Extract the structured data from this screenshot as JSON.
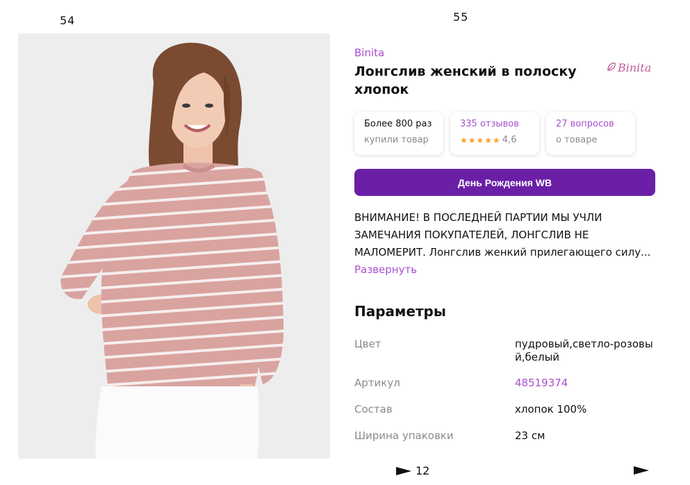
{
  "pages": {
    "left": "54",
    "right": "55"
  },
  "product": {
    "brand": "Binita",
    "title": "Лонгслив женский в полоску хлопок",
    "logo_text": "Binita"
  },
  "stats": [
    {
      "line1": "Более 800 раз",
      "line2": "купили товар"
    },
    {
      "line1": "335 отзывов",
      "line2": "4,6",
      "stars": "★★★★★"
    },
    {
      "line1": "27 вопросов",
      "line2": "о товаре"
    }
  ],
  "promo_label": "День Рождения WB",
  "description": "ВНИМАНИЕ! В ПОСЛЕДНЕЙ ПАРТИИ МЫ УЧЛИ ЗАМЕЧАНИЯ ПОКУПАТЕЛЕЙ, ЛОНГСЛИВ НЕ МАЛОМЕРИТ. Лонгслив женкий прилегающего силу...",
  "expand_label": "Развернуть",
  "params": {
    "heading": "Параметры",
    "rows": [
      {
        "key": "Цвет",
        "value": "пудровый,светло-розовый,белый"
      },
      {
        "key": "Артикул",
        "value": "48519374"
      },
      {
        "key": "Состав",
        "value": "хлопок 100%"
      },
      {
        "key": "Ширина упаковки",
        "value": "23 см"
      }
    ]
  },
  "nav": {
    "next_page": "12"
  },
  "colors": {
    "accent": "#a94fd1",
    "promo": "#6a1fa6",
    "stars": "#f5a623"
  }
}
